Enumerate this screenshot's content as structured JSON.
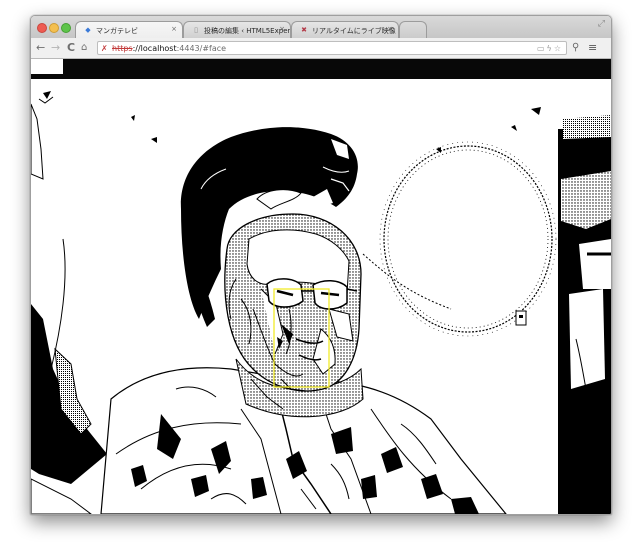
{
  "browser": {
    "tabs": [
      {
        "label": "マンガテレビ",
        "favicon": "globe-icon"
      },
      {
        "label": "投稿の編集 ‹ HTML5Experi",
        "favicon": "page-icon"
      },
      {
        "label": "リアルタイムにライブ映像",
        "favicon": "recording-icon"
      }
    ],
    "active_tab": 0,
    "address": {
      "scheme": "https",
      "host_text": "://localhost",
      "path": ":4443/#face"
    }
  },
  "camera": {
    "mode": "threshold-manga-filter",
    "face_detected": true
  },
  "colors": {
    "face_box": "#f2ea2a",
    "ink": "#000000",
    "paper": "#ffffff"
  }
}
